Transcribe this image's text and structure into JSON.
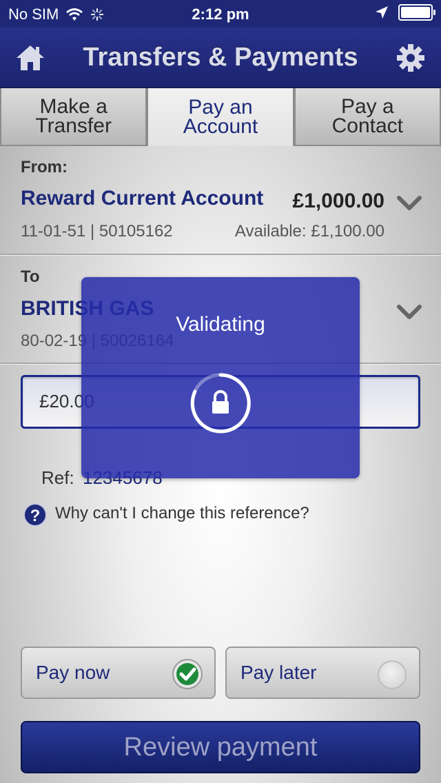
{
  "status_bar": {
    "carrier": "No SIM",
    "time": "2:12 pm"
  },
  "header": {
    "title": "Transfers & Payments",
    "left_icon": "home-icon",
    "right_icon": "gear-icon"
  },
  "tabs": [
    {
      "line1": "Make a",
      "line2": "Transfer",
      "active": false
    },
    {
      "line1": "Pay an",
      "line2": "Account",
      "active": true
    },
    {
      "line1": "Pay a",
      "line2": "Contact",
      "active": false
    }
  ],
  "from": {
    "label": "From:",
    "account_name": "Reward Current Account",
    "balance": "£1,000.00",
    "account_details": "11-01-51 | 50105162",
    "available": "Available: £1,100.00"
  },
  "to": {
    "label": "To",
    "payee_name": "BRITISH GAS",
    "payee_details": "80-02-19 | 50026164"
  },
  "amount": {
    "value": "£20.00"
  },
  "reference": {
    "label": "Ref:",
    "value": "12345678",
    "help_text": "Why can't I change this reference?"
  },
  "pay_options": {
    "now_label": "Pay now",
    "later_label": "Pay later",
    "selected": "now"
  },
  "review_button": {
    "label": "Review payment"
  },
  "overlay": {
    "title": "Validating",
    "icon": "lock-icon"
  },
  "colors": {
    "brand_navy": "#1e2877",
    "accent_text": "#1e2a7a",
    "check_green": "#1f8a3a"
  }
}
